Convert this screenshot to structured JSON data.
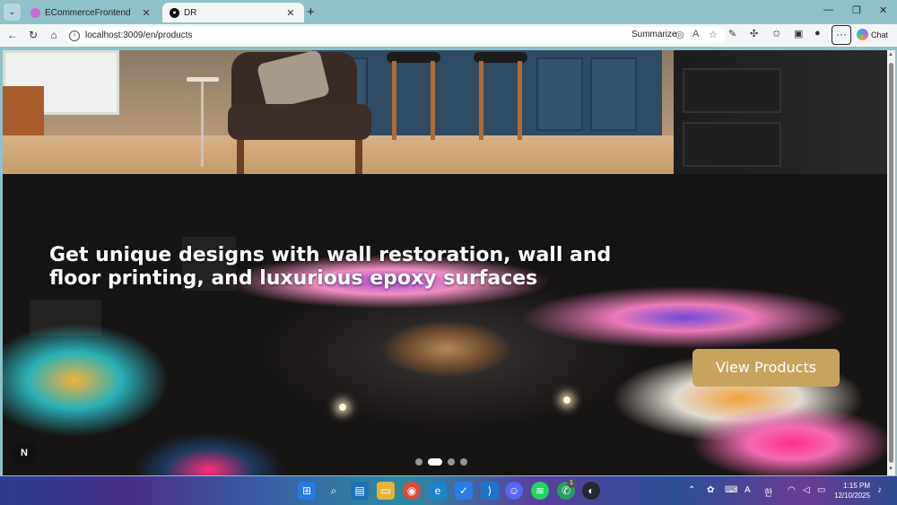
{
  "browser": {
    "tabs": [
      {
        "title": "ECommerceFrontend",
        "active": false
      },
      {
        "title": "DR",
        "active": true
      }
    ],
    "url": "localhost:3009/en/products",
    "summarize_label": "Summarize",
    "chat_label": "Chat"
  },
  "page": {
    "hero_heading": "Get unique designs with wall restoration, wall and floor printing, and luxurious epoxy surfaces",
    "cta_label": "View Products",
    "carousel": {
      "slides": 4,
      "active_index": 1
    },
    "badge_label": "N"
  },
  "taskbar": {
    "time": "1:15 PM",
    "date": "12/10/2025",
    "notification_count": "1"
  },
  "colors": {
    "accent_button": "#c8a35e",
    "browser_chrome": "#8fc1c9"
  }
}
